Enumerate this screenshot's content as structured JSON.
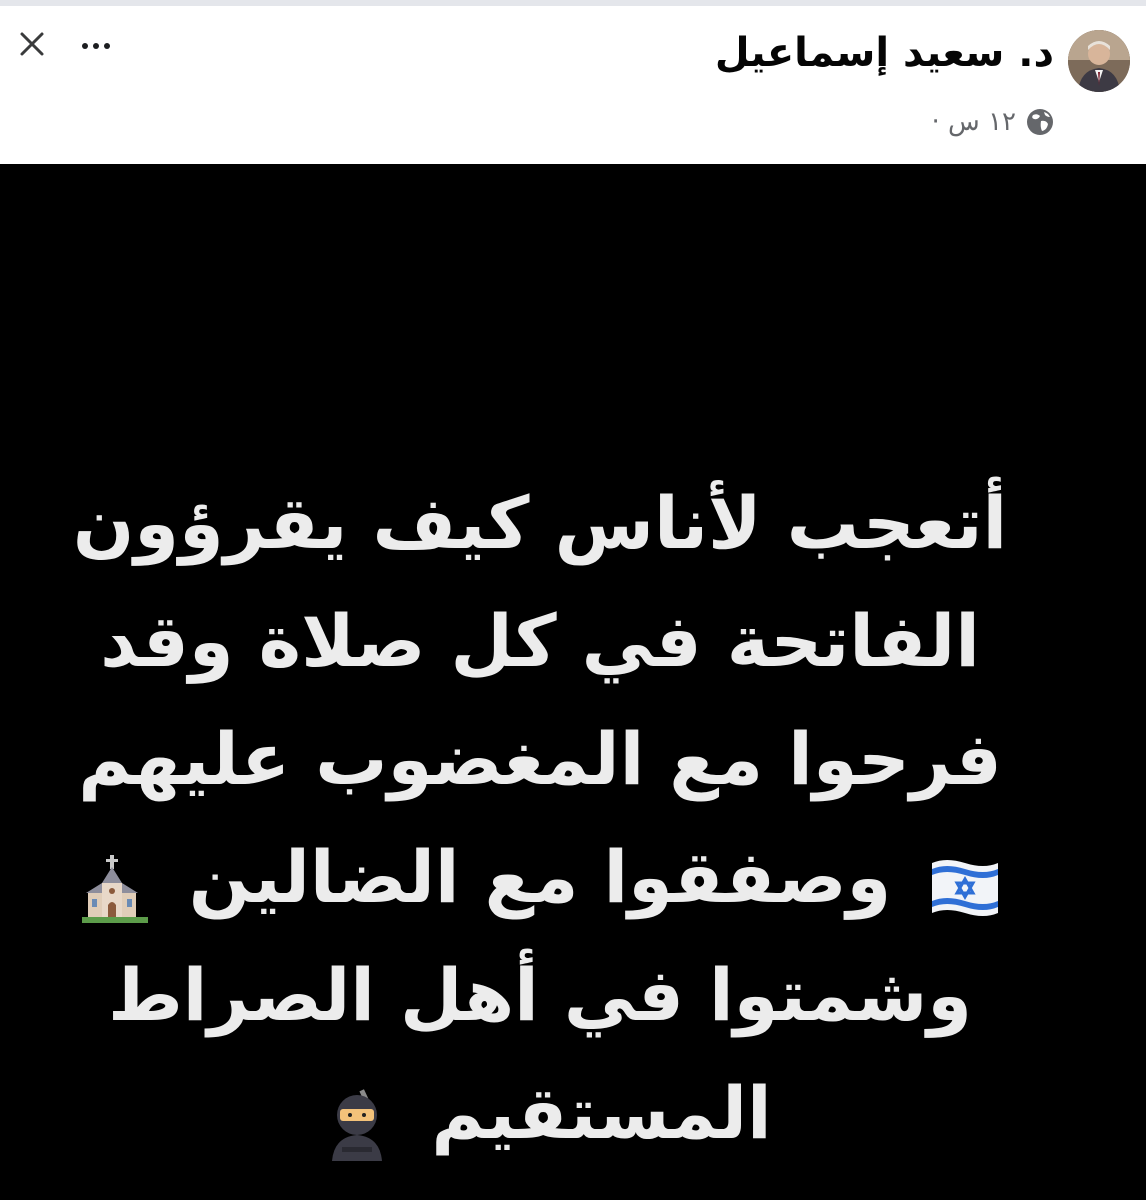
{
  "post": {
    "author_name": "د. سعيد إسماعيل",
    "timestamp": "١٢ س ·",
    "privacy_icon": "globe-icon",
    "close_icon": "close-icon",
    "more_icon": "more-options-icon"
  },
  "image": {
    "background_color": "#000000",
    "text_color": "#ececec",
    "lines": [
      "أتعجب لأناس كيف يقرؤون",
      "الفاتحة في كل صلاة وقد",
      "فرحوا مع المغضوب عليهم",
      "وصفقوا مع الضالين",
      "وشمتوا في أهل الصراط",
      "المستقيم"
    ],
    "emojis": {
      "flag": "israel-flag-icon",
      "church": "church-icon",
      "ninja": "ninja-icon"
    }
  }
}
